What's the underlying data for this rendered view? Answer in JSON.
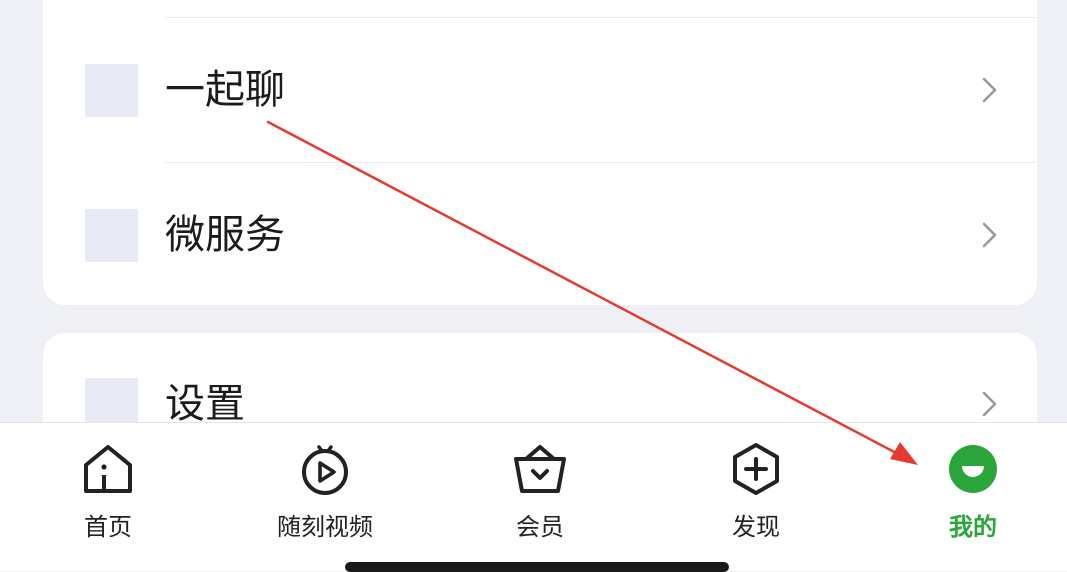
{
  "menu": {
    "group1": [
      {
        "label": "一起聊"
      },
      {
        "label": "微服务"
      }
    ],
    "group2": [
      {
        "label": "设置"
      }
    ]
  },
  "tabbar": {
    "tabs": [
      {
        "label": "首页",
        "icon": "home-icon"
      },
      {
        "label": "随刻视频",
        "icon": "video-icon"
      },
      {
        "label": "会员",
        "icon": "vip-basket-icon"
      },
      {
        "label": "发现",
        "icon": "plus-hexagon-icon"
      },
      {
        "label": "我的",
        "icon": "profile-face-icon",
        "active": true
      }
    ]
  },
  "colors": {
    "accent": "#2aa53a",
    "annotation_arrow": "#e53a2e",
    "background": "#eef0f6"
  }
}
